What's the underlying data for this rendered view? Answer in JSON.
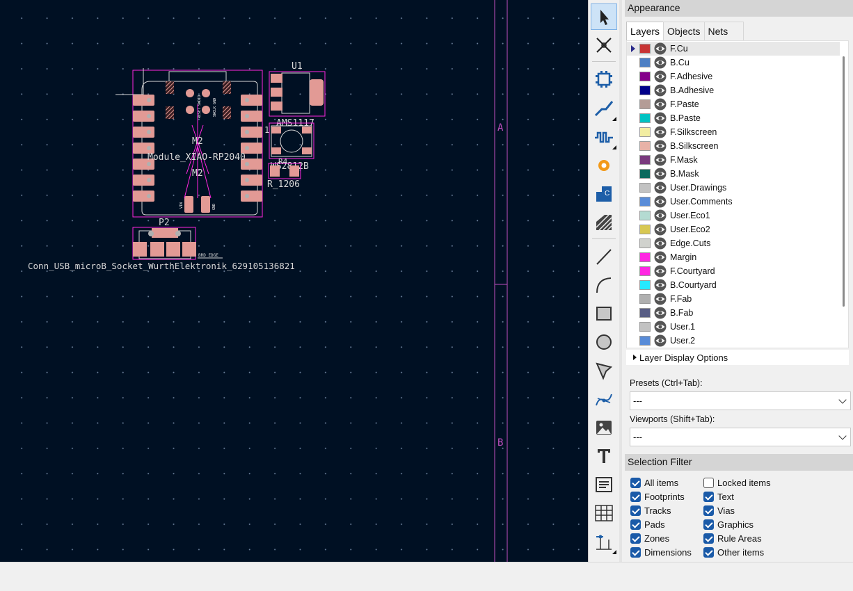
{
  "canvas": {
    "sheet_zone_labels": [
      "A",
      "B"
    ],
    "footprints": {
      "u1_ref": "U1",
      "u1_value": "AMS1117",
      "u2_value": "WS2812B",
      "m2_ref": "M2",
      "m2_value": "Module_XIAO-RP2040",
      "m2_ref2": "M2",
      "r_value": "R_1206",
      "r_ref": "R4",
      "p2_ref": "P2",
      "p2_value": "Conn_USB_microB_Socket_WurthElektronik_629105136821",
      "brd_edge": "BRD EDGE",
      "pad1": "1",
      "reset_label": "RESET SWDIO",
      "swclk_label": "SWCLK GND",
      "vin_label": "VIN",
      "gnd_label": "GND"
    }
  },
  "toolbar": {
    "tools": [
      "select-tool",
      "local-ratsnest-tool",
      "add-footprint-tool",
      "route-track-tool",
      "tune-length-tool",
      "add-via-tool",
      "add-zone-tool",
      "add-rule-area-tool",
      "draw-line-tool",
      "draw-arc-tool",
      "draw-rectangle-tool",
      "draw-circle-tool",
      "draw-polygon-tool",
      "draw-bezier-tool",
      "add-image-tool",
      "add-text-tool",
      "add-textbox-tool",
      "add-table-tool",
      "add-dimension-tool"
    ]
  },
  "appearance": {
    "title": "Appearance",
    "tabs": [
      "Layers",
      "Objects",
      "Nets"
    ],
    "active_tab": "Layers",
    "layers": [
      {
        "name": "F.Cu",
        "color": "#c83434"
      },
      {
        "name": "B.Cu",
        "color": "#4d7fc4"
      },
      {
        "name": "F.Adhesive",
        "color": "#84008a"
      },
      {
        "name": "B.Adhesive",
        "color": "#00008a"
      },
      {
        "name": "F.Paste",
        "color": "#b49c96"
      },
      {
        "name": "B.Paste",
        "color": "#00c2c2"
      },
      {
        "name": "F.Silkscreen",
        "color": "#f2eda1"
      },
      {
        "name": "B.Silkscreen",
        "color": "#e8b2a7"
      },
      {
        "name": "F.Mask",
        "color": "#7a3a7e"
      },
      {
        "name": "B.Mask",
        "color": "#0a6a5e"
      },
      {
        "name": "User.Drawings",
        "color": "#c2c2c2"
      },
      {
        "name": "User.Comments",
        "color": "#598cd8"
      },
      {
        "name": "User.Eco1",
        "color": "#b4dbd2"
      },
      {
        "name": "User.Eco2",
        "color": "#d8c852"
      },
      {
        "name": "Edge.Cuts",
        "color": "#d0d2cd"
      },
      {
        "name": "Margin",
        "color": "#ff26e2"
      },
      {
        "name": "F.Courtyard",
        "color": "#ff26e2"
      },
      {
        "name": "B.Courtyard",
        "color": "#26e9ff"
      },
      {
        "name": "F.Fab",
        "color": "#afafaf"
      },
      {
        "name": "B.Fab",
        "color": "#585d84"
      },
      {
        "name": "User.1",
        "color": "#c2c2c2"
      },
      {
        "name": "User.2",
        "color": "#598cd8"
      }
    ],
    "display_options": "Layer Display Options",
    "presets_label": "Presets (Ctrl+Tab):",
    "presets_value": "---",
    "viewports_label": "Viewports (Shift+Tab):",
    "viewports_value": "---"
  },
  "selection_filter": {
    "title": "Selection Filter",
    "left": [
      {
        "label": "All items",
        "checked": true
      },
      {
        "label": "Footprints",
        "checked": true
      },
      {
        "label": "Tracks",
        "checked": true
      },
      {
        "label": "Pads",
        "checked": true
      },
      {
        "label": "Zones",
        "checked": true
      },
      {
        "label": "Dimensions",
        "checked": true
      }
    ],
    "right": [
      {
        "label": "Locked items",
        "checked": false
      },
      {
        "label": "Text",
        "checked": true
      },
      {
        "label": "Vias",
        "checked": true
      },
      {
        "label": "Graphics",
        "checked": true
      },
      {
        "label": "Rule Areas",
        "checked": true
      },
      {
        "label": "Other items",
        "checked": true
      }
    ]
  }
}
